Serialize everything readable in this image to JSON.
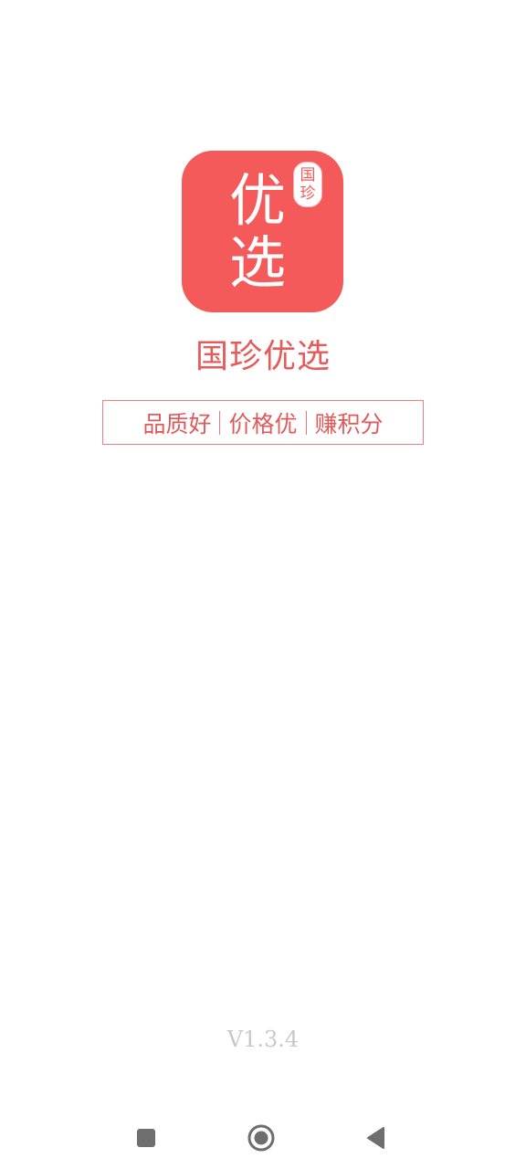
{
  "app_icon": {
    "main_chars": [
      "优",
      "选"
    ],
    "seal_chars": [
      "国",
      "珍"
    ],
    "color": "#f45a5a"
  },
  "app_name": "国珍优选",
  "slogan": {
    "items": [
      "品质好",
      "价格优",
      "赚积分"
    ]
  },
  "version": "V1.3.4",
  "navigation": {
    "recents_icon": "square-icon",
    "home_icon": "circle-icon",
    "back_icon": "triangle-back-icon"
  }
}
